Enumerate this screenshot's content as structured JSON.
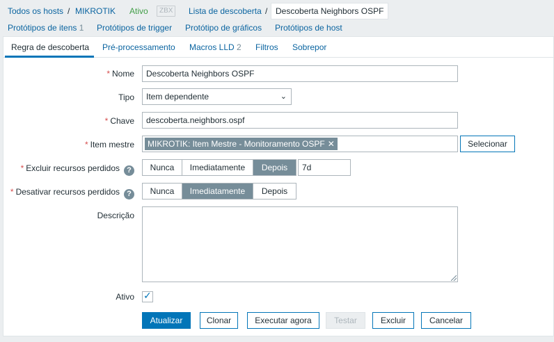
{
  "breadcrumb": {
    "all_hosts": "Todos os hosts",
    "sep1": "/",
    "host": "MIKROTIK",
    "status": "Ativo",
    "zbx": "ZBX",
    "discovery_list": "Lista de descoberta",
    "sep2": "/",
    "current": "Descoberta Neighbors OSPF"
  },
  "sublinks": {
    "item_prototypes": "Protótipos de itens",
    "item_prototypes_count": "1",
    "trigger_prototypes": "Protótipos de trigger",
    "graph_prototypes": "Protótipo de gráficos",
    "host_prototypes": "Protótipos de host"
  },
  "tabs": [
    {
      "label": "Regra de descoberta",
      "count": ""
    },
    {
      "label": "Pré-processamento",
      "count": ""
    },
    {
      "label": "Macros LLD",
      "count": "2"
    },
    {
      "label": "Filtros",
      "count": ""
    },
    {
      "label": "Sobrepor",
      "count": ""
    }
  ],
  "form": {
    "name_label": "Nome",
    "name_value": "Descoberta Neighbors OSPF",
    "type_label": "Tipo",
    "type_value": "Item dependente",
    "key_label": "Chave",
    "key_value": "descoberta.neighbors.ospf",
    "master_label": "Item mestre",
    "master_value": "MIKROTIK: Item Mestre - Monitoramento OSPF",
    "select_button": "Selecionar",
    "delete_lost_label": "Excluir recursos perdidos",
    "delete_lost_options": [
      "Nunca",
      "Imediatamente",
      "Depois"
    ],
    "delete_lost_selected": "Depois",
    "delete_lost_value": "7d",
    "disable_lost_label": "Desativar recursos perdidos",
    "disable_lost_options": [
      "Nunca",
      "Imediatamente",
      "Depois"
    ],
    "disable_lost_selected": "Imediatamente",
    "description_label": "Descrição",
    "description_value": "",
    "enabled_label": "Ativo",
    "enabled_checked": true,
    "required_mark": "*",
    "help_mark": "?"
  },
  "actions": {
    "update": "Atualizar",
    "clone": "Clonar",
    "execute_now": "Executar agora",
    "test": "Testar",
    "delete": "Excluir",
    "cancel": "Cancelar"
  },
  "colors": {
    "link": "#0a64a0",
    "primary": "#0275b8",
    "active_status": "#429e47",
    "required": "#d64e4e",
    "selected_segment": "#768d99"
  }
}
